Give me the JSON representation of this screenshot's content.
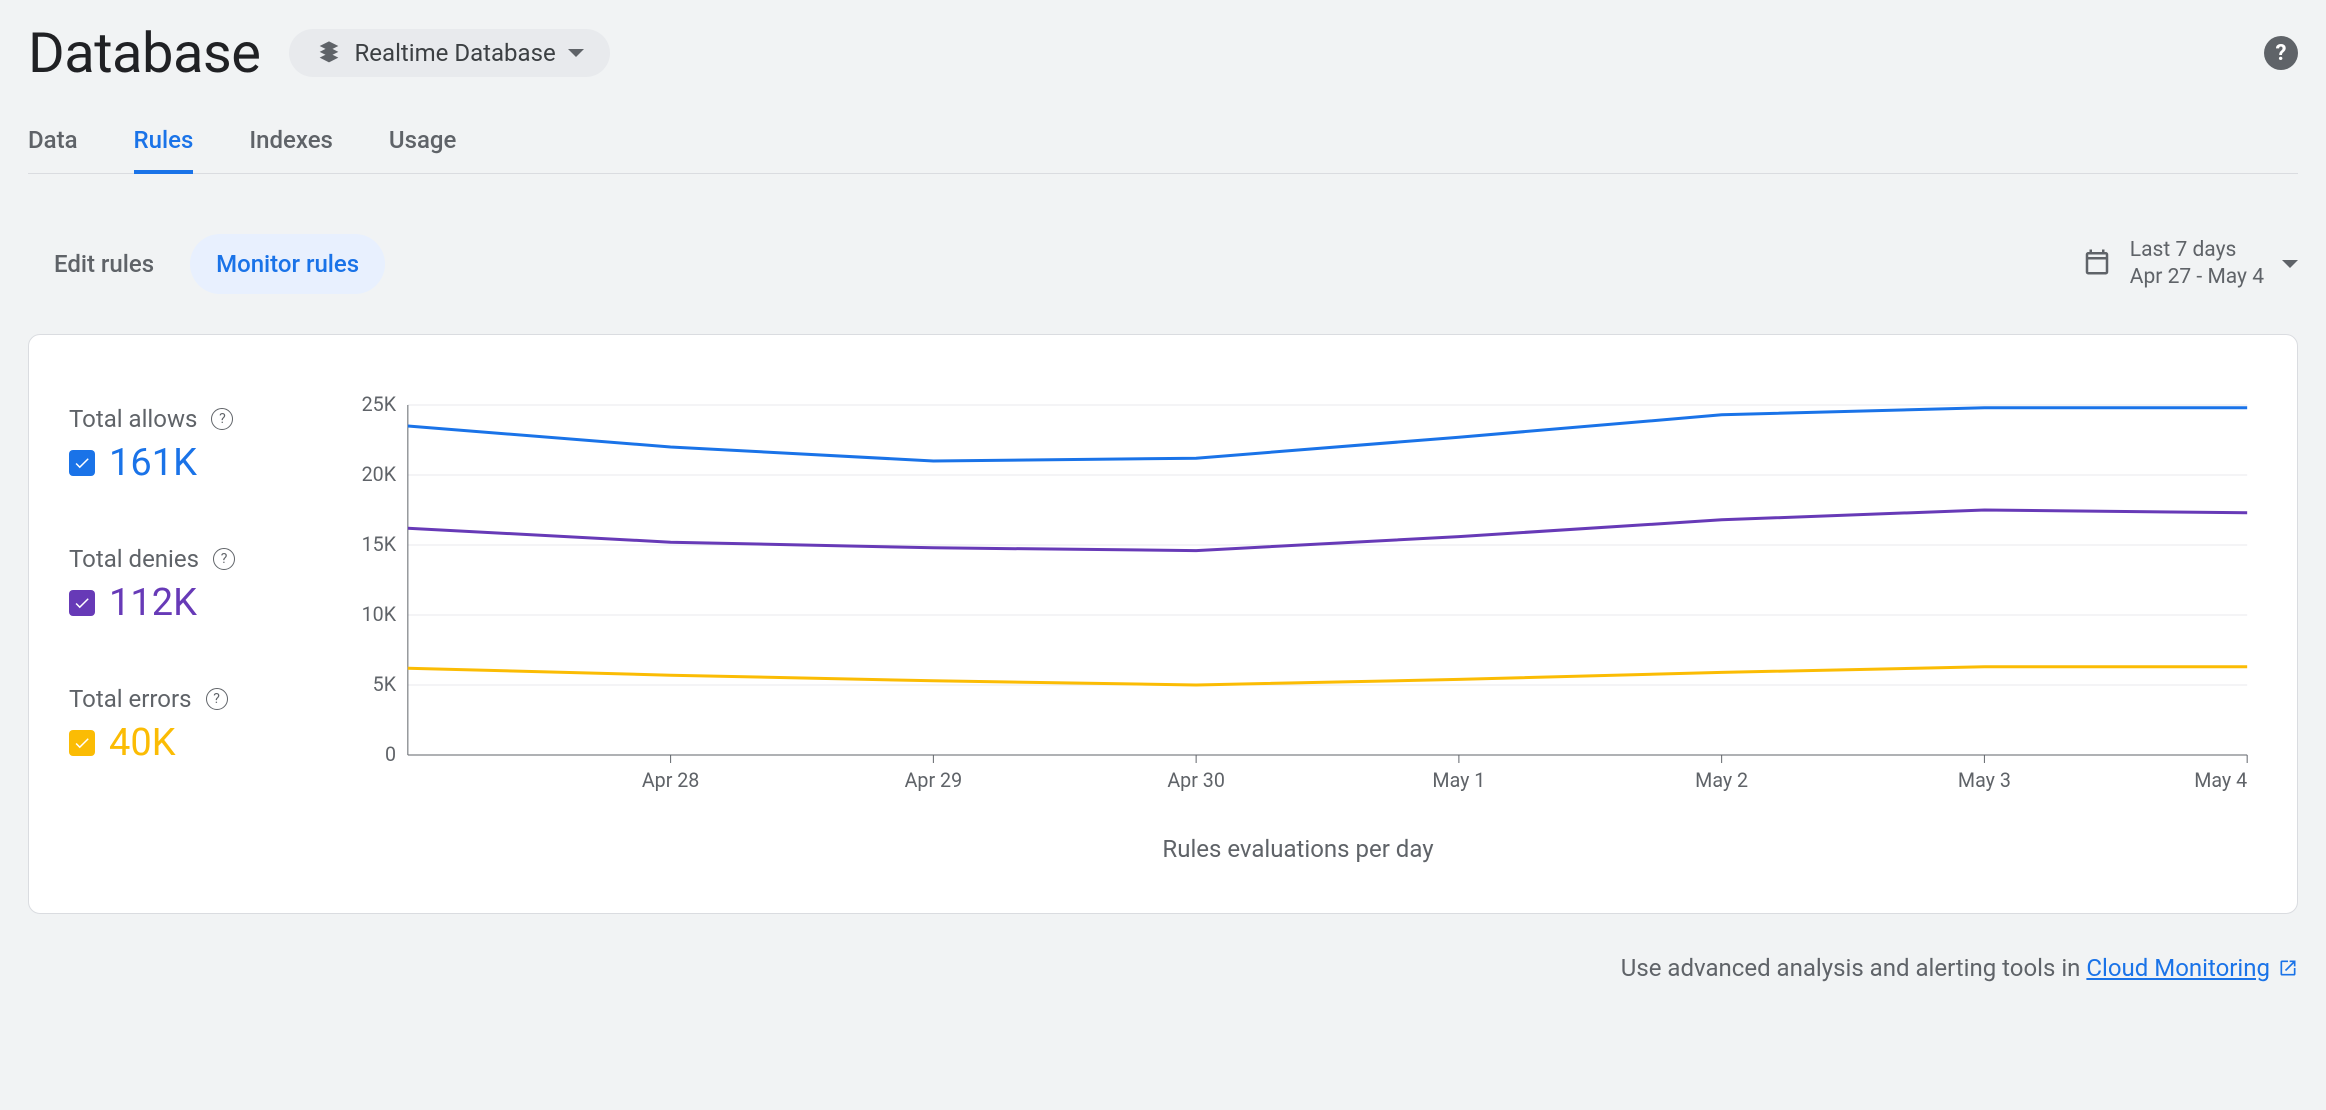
{
  "header": {
    "title": "Database",
    "db_selector_label": "Realtime Database"
  },
  "main_tabs": [
    {
      "label": "Data",
      "active": false
    },
    {
      "label": "Rules",
      "active": true
    },
    {
      "label": "Indexes",
      "active": false
    },
    {
      "label": "Usage",
      "active": false
    }
  ],
  "sub_tabs": [
    {
      "label": "Edit rules",
      "active": false
    },
    {
      "label": "Monitor rules",
      "active": true
    }
  ],
  "date_picker": {
    "range_label": "Last 7 days",
    "range_detail": "Apr 27 - May 4"
  },
  "legend": [
    {
      "label": "Total allows",
      "value": "161K",
      "color": "#1a73e8"
    },
    {
      "label": "Total denies",
      "value": "112K",
      "color": "#673ab7"
    },
    {
      "label": "Total errors",
      "value": "40K",
      "color": "#fbbc04"
    }
  ],
  "chart_data": {
    "type": "line",
    "xlabel": "Rules evaluations per day",
    "ylabel": "",
    "categories": [
      "Apr 28",
      "Apr 29",
      "Apr 30",
      "May 1",
      "May 2",
      "May 3",
      "May 4"
    ],
    "y_ticks": [
      0,
      5000,
      10000,
      15000,
      20000,
      25000
    ],
    "y_tick_labels": [
      "0",
      "5K",
      "10K",
      "15K",
      "20K",
      "25K"
    ],
    "ylim": [
      0,
      25000
    ],
    "series": [
      {
        "name": "Total allows",
        "color": "#1a73e8",
        "values": [
          23500,
          22000,
          21000,
          21200,
          22700,
          24300,
          24800,
          24800
        ]
      },
      {
        "name": "Total denies",
        "color": "#673ab7",
        "values": [
          16200,
          15200,
          14800,
          14600,
          15600,
          16800,
          17500,
          17300
        ]
      },
      {
        "name": "Total errors",
        "color": "#fbbc04",
        "values": [
          6200,
          5700,
          5300,
          5000,
          5400,
          5900,
          6300,
          6300
        ]
      }
    ]
  },
  "footer": {
    "text": "Use advanced analysis and alerting tools in ",
    "link_text": "Cloud Monitoring"
  }
}
